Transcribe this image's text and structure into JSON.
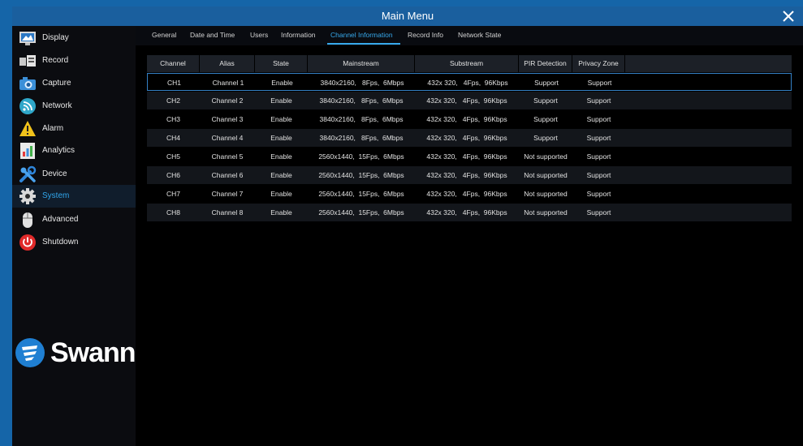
{
  "window": {
    "title": "Main Menu",
    "close_icon": "close-icon"
  },
  "sidebar": {
    "items": [
      {
        "label": "Display",
        "icon": "display-icon"
      },
      {
        "label": "Record",
        "icon": "record-icon"
      },
      {
        "label": "Capture",
        "icon": "camera-icon"
      },
      {
        "label": "Network",
        "icon": "network-icon"
      },
      {
        "label": "Alarm",
        "icon": "alarm-icon"
      },
      {
        "label": "Analytics",
        "icon": "analytics-icon"
      },
      {
        "label": "Device",
        "icon": "device-icon"
      },
      {
        "label": "System",
        "icon": "gear-icon",
        "active": true
      },
      {
        "label": "Advanced",
        "icon": "mouse-icon"
      },
      {
        "label": "Shutdown",
        "icon": "power-icon"
      }
    ],
    "logo_text": "Swann"
  },
  "tabs": [
    {
      "label": "General"
    },
    {
      "label": "Date and Time"
    },
    {
      "label": "Users"
    },
    {
      "label": "Information"
    },
    {
      "label": "Channel Information",
      "active": true
    },
    {
      "label": "Record Info"
    },
    {
      "label": "Network State"
    }
  ],
  "table": {
    "headers": [
      "Channel",
      "Alias",
      "State",
      "Mainstream",
      "Substream",
      "PIR Detection",
      "Privacy Zone"
    ],
    "rows": [
      [
        "CH1",
        "Channel 1",
        "Enable",
        "3840x2160,   8Fps,  6Mbps",
        "432x 320,   4Fps,  96Kbps",
        "Support",
        "Support"
      ],
      [
        "CH2",
        "Channel 2",
        "Enable",
        "3840x2160,   8Fps,  6Mbps",
        "432x 320,   4Fps,  96Kbps",
        "Support",
        "Support"
      ],
      [
        "CH3",
        "Channel 3",
        "Enable",
        "3840x2160,   8Fps,  6Mbps",
        "432x 320,   4Fps,  96Kbps",
        "Support",
        "Support"
      ],
      [
        "CH4",
        "Channel 4",
        "Enable",
        "3840x2160,   8Fps,  6Mbps",
        "432x 320,   4Fps,  96Kbps",
        "Support",
        "Support"
      ],
      [
        "CH5",
        "Channel 5",
        "Enable",
        "2560x1440,  15Fps,  6Mbps",
        "432x 320,   4Fps,  96Kbps",
        "Not supported",
        "Support"
      ],
      [
        "CH6",
        "Channel 6",
        "Enable",
        "2560x1440,  15Fps,  6Mbps",
        "432x 320,   4Fps,  96Kbps",
        "Not supported",
        "Support"
      ],
      [
        "CH7",
        "Channel 7",
        "Enable",
        "2560x1440,  15Fps,  6Mbps",
        "432x 320,   4Fps,  96Kbps",
        "Not supported",
        "Support"
      ],
      [
        "CH8",
        "Channel 8",
        "Enable",
        "2560x1440,  15Fps,  6Mbps",
        "432x 320,   4Fps,  96Kbps",
        "Not supported",
        "Support"
      ]
    ],
    "selected_row": 0
  },
  "colors": {
    "accent": "#37a9ec",
    "titlebar": "#1a5f9e",
    "frame": "#1565a8"
  }
}
